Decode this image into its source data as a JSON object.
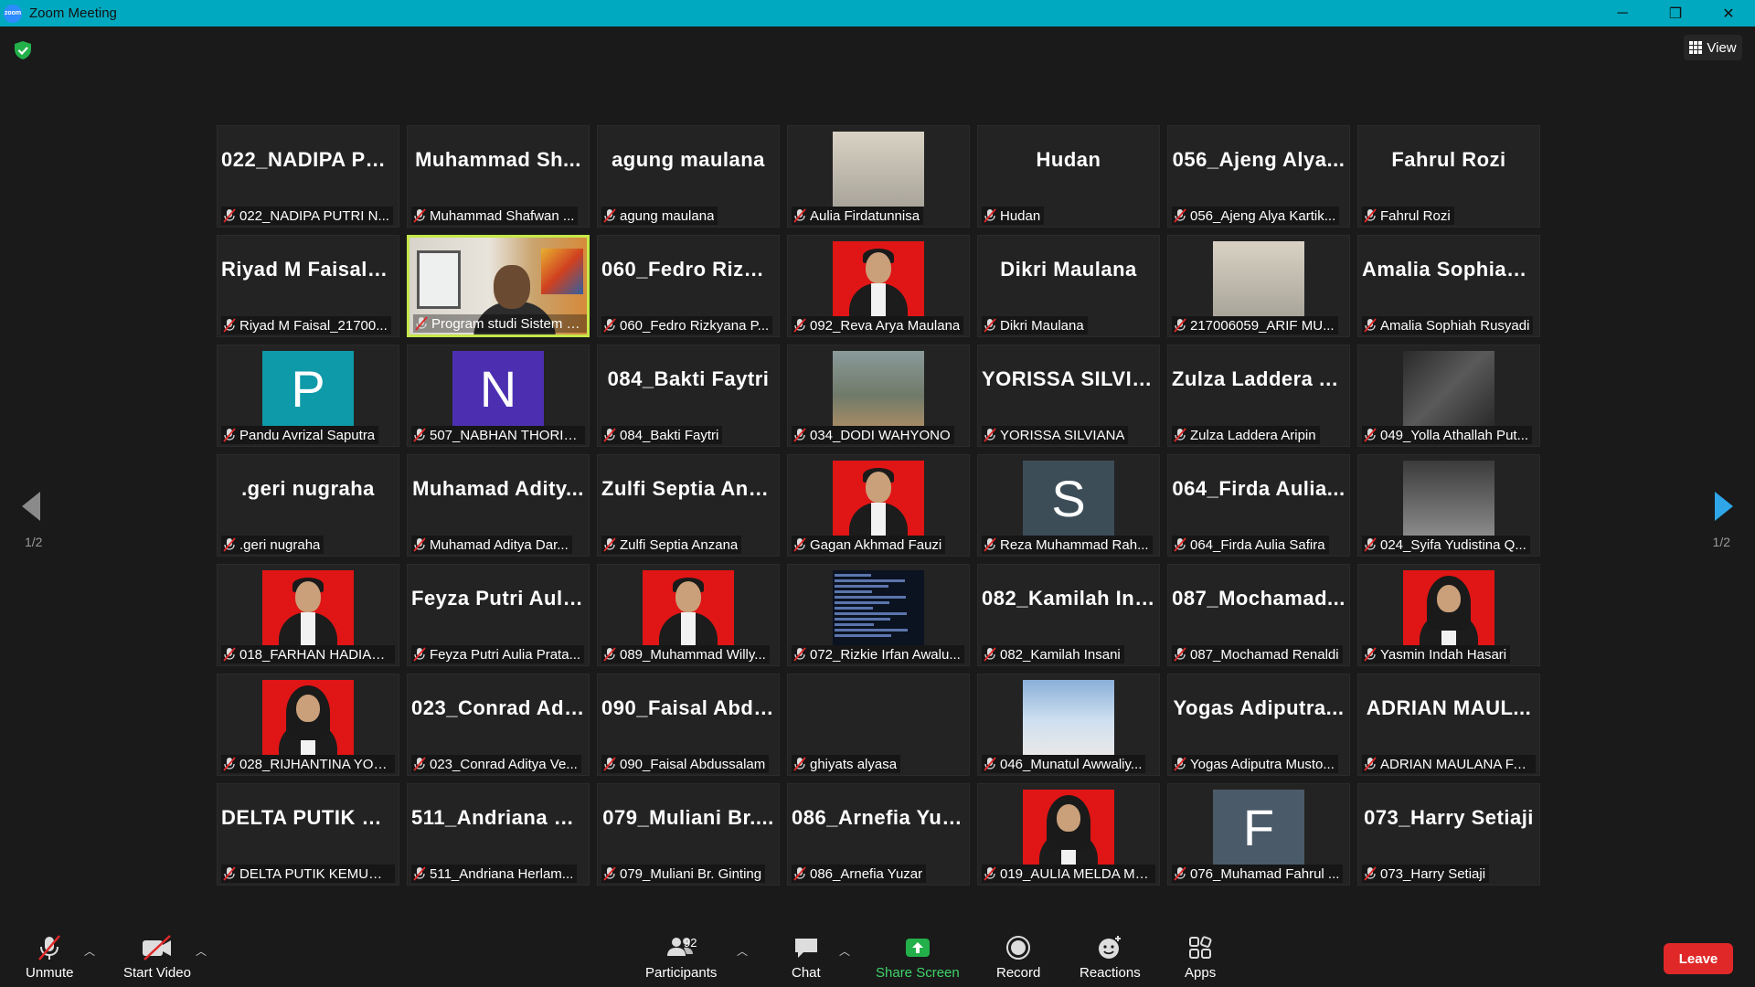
{
  "window": {
    "title": "Zoom Meeting",
    "logo_text": "zoom",
    "minimize": "─",
    "restore": "❐",
    "close": "✕"
  },
  "view_button": {
    "label": "View"
  },
  "pagination": {
    "left": "1/2",
    "right": "1/2"
  },
  "tiles": [
    {
      "big": "022_NADIPA PU...",
      "label": "022_NADIPA PUTRI N...",
      "kind": "text"
    },
    {
      "big": "Muhammad Sh...",
      "label": "Muhammad Shafwan ...",
      "kind": "text"
    },
    {
      "big": "agung maulana",
      "label": "agung maulana",
      "kind": "text"
    },
    {
      "big": "",
      "label": "Aulia Firdatunnisa",
      "kind": "photo-person"
    },
    {
      "big": "Hudan",
      "label": "Hudan",
      "kind": "text"
    },
    {
      "big": "056_Ajeng Alya...",
      "label": "056_Ajeng Alya Kartik...",
      "kind": "text"
    },
    {
      "big": "Fahrul Rozi",
      "label": "Fahrul Rozi",
      "kind": "text"
    },
    {
      "big": "Riyad M Faisal_...",
      "label": "Riyad M Faisal_21700...",
      "kind": "text"
    },
    {
      "big": "",
      "label": "Program studi Sistem Info...",
      "kind": "video"
    },
    {
      "big": "060_Fedro Rizky...",
      "label": "060_Fedro Rizkyana P...",
      "kind": "text"
    },
    {
      "big": "",
      "label": "092_Reva Arya Maulana",
      "kind": "photo-red"
    },
    {
      "big": "Dikri Maulana",
      "label": "Dikri Maulana",
      "kind": "text"
    },
    {
      "big": "",
      "label": "217006059_ARIF MU...",
      "kind": "photo-person"
    },
    {
      "big": "Amalia Sophiah...",
      "label": "Amalia Sophiah Rusyadi",
      "kind": "text"
    },
    {
      "big": "",
      "label": "Pandu Avrizal Saputra",
      "kind": "letter",
      "letter": "P",
      "color": "#0e9aa8"
    },
    {
      "big": "",
      "label": "507_NABHAN THORIQ...",
      "kind": "letter",
      "letter": "N",
      "color": "#4b2fb0"
    },
    {
      "big": "084_Bakti Faytri",
      "label": "084_Bakti Faytri",
      "kind": "text"
    },
    {
      "big": "",
      "label": "034_DODI WAHYONO",
      "kind": "photo-scene"
    },
    {
      "big": "YORISSA SILVIA...",
      "label": "YORISSA SILVIANA",
      "kind": "text"
    },
    {
      "big": "Zulza Laddera A...",
      "label": "Zulza Laddera Aripin",
      "kind": "text"
    },
    {
      "big": "",
      "label": "049_Yolla Athallah Put...",
      "kind": "photo-dark"
    },
    {
      "big": ".geri nugraha",
      "label": ".geri nugraha",
      "kind": "text"
    },
    {
      "big": "Muhamad Adity...",
      "label": "Muhamad Aditya Dar...",
      "kind": "text"
    },
    {
      "big": "Zulfi Septia Anz...",
      "label": "Zulfi Septia Anzana",
      "kind": "text"
    },
    {
      "big": "",
      "label": "Gagan Akhmad Fauzi",
      "kind": "photo-red"
    },
    {
      "big": "",
      "label": "Reza Muhammad Rah...",
      "kind": "letter",
      "letter": "S",
      "color": "#3d4d58"
    },
    {
      "big": "064_Firda Aulia...",
      "label": "064_Firda Aulia Safira",
      "kind": "text"
    },
    {
      "big": "",
      "label": "024_Syifa Yudistina Q...",
      "kind": "photo-portrait-dark"
    },
    {
      "big": "",
      "label": "018_FARHAN HADIAN...",
      "kind": "photo-red"
    },
    {
      "big": "Feyza Putri Auli...",
      "label": "Feyza Putri Aulia Prata...",
      "kind": "text"
    },
    {
      "big": "",
      "label": "089_Muhammad Willy...",
      "kind": "photo-red"
    },
    {
      "big": "",
      "label": "072_Rizkie Irfan Awalu...",
      "kind": "photo-terminal"
    },
    {
      "big": "082_Kamilah Ins...",
      "label": "082_Kamilah Insani",
      "kind": "text"
    },
    {
      "big": "087_Mochamad...",
      "label": "087_Mochamad Renaldi",
      "kind": "text"
    },
    {
      "big": "",
      "label": "Yasmin Indah Hasari",
      "kind": "photo-red-hijab"
    },
    {
      "big": "",
      "label": "028_RIJHANTINA YOH...",
      "kind": "photo-red-hijab"
    },
    {
      "big": "023_Conrad Adi...",
      "label": "023_Conrad Aditya Ve...",
      "kind": "text"
    },
    {
      "big": "090_Faisal Abdu...",
      "label": "090_Faisal Abdussalam",
      "kind": "text"
    },
    {
      "big": "",
      "label": "ghiyats alyasa",
      "kind": "text"
    },
    {
      "big": "",
      "label": "046_Munatul Awwaliy...",
      "kind": "photo-blue"
    },
    {
      "big": "Yogas Adiputra...",
      "label": "Yogas Adiputra Musto...",
      "kind": "text"
    },
    {
      "big": "ADRIAN MAUL...",
      "label": "ADRIAN MAULANA FA...",
      "kind": "text"
    },
    {
      "big": "DELTA PUTIK KE...",
      "label": "DELTA PUTIK KEMUNI...",
      "kind": "text"
    },
    {
      "big": "511_Andriana H...",
      "label": "511_Andriana Herlam...",
      "kind": "text"
    },
    {
      "big": "079_Muliani Br....",
      "label": "079_Muliani Br. Ginting",
      "kind": "text"
    },
    {
      "big": "086_Arnefia Yuzar",
      "label": "086_Arnefia Yuzar",
      "kind": "text"
    },
    {
      "big": "",
      "label": "019_AULIA MELDA ME...",
      "kind": "photo-red-hijab"
    },
    {
      "big": "",
      "label": "076_Muhamad Fahrul ...",
      "kind": "letter",
      "letter": "F",
      "color": "#4a5a68"
    },
    {
      "big": "073_Harry Setiaji",
      "label": "073_Harry Setiaji",
      "kind": "text"
    }
  ],
  "toolbar": {
    "unmute": "Unmute",
    "start_video": "Start Video",
    "participants": "Participants",
    "participants_count": "92",
    "chat": "Chat",
    "share_screen": "Share Screen",
    "record": "Record",
    "reactions": "Reactions",
    "apps": "Apps",
    "leave": "Leave"
  },
  "colors": {
    "titlebar": "#00a9c0",
    "active_speaker": "#c6e84a",
    "share": "#3fd36a",
    "leave": "#e02828",
    "nav_arrow": "#2fa6e8"
  }
}
